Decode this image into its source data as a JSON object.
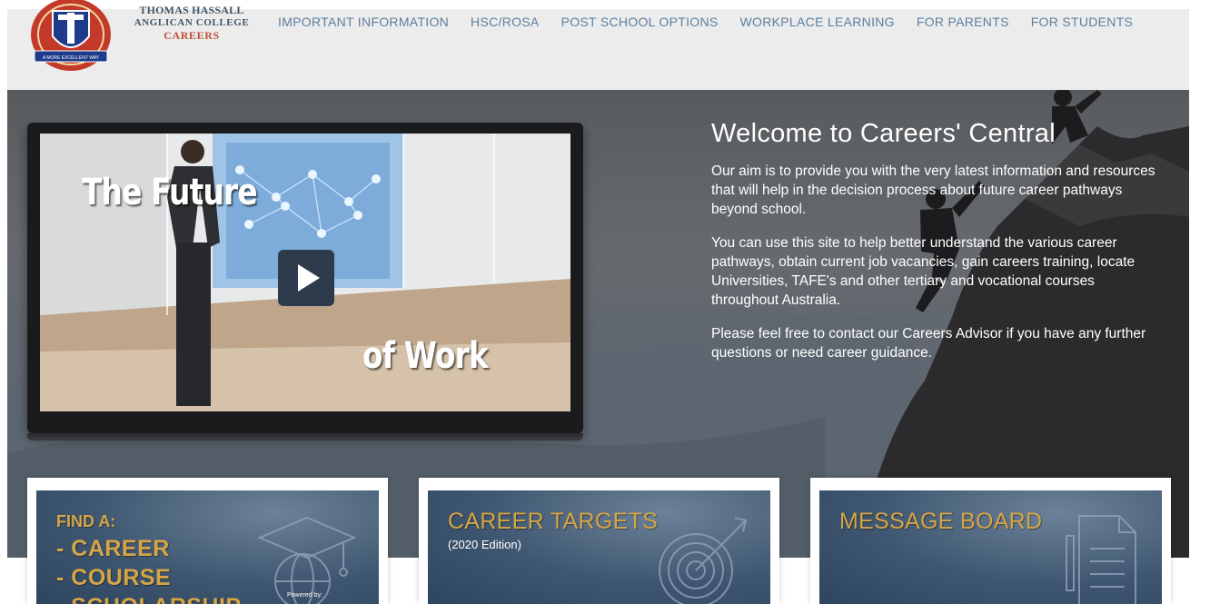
{
  "header": {
    "brand_line1": "THOMAS HASSALL",
    "brand_line2": "ANGLICAN COLLEGE",
    "brand_line3": "CAREERS",
    "crest_motto": "A MORE EXCELLENT WAY",
    "nav": [
      {
        "label": "IMPORTANT INFORMATION"
      },
      {
        "label": "HSC/ROSA"
      },
      {
        "label": "POST SCHOOL OPTIONS"
      },
      {
        "label": "WORKPLACE LEARNING"
      },
      {
        "label": "FOR PARENTS"
      },
      {
        "label": "FOR STUDENTS"
      }
    ]
  },
  "video": {
    "title_line1": "The Future",
    "title_line2": "of Work",
    "play_icon": "play-icon"
  },
  "welcome": {
    "heading": "Welcome to Careers' Central",
    "p1": "Our aim is to provide you with the very latest information and resources that will help in the decision process about future career pathways beyond school.",
    "p2": "You can use this site to help better understand the various career pathways, obtain current job vacancies, gain careers training, locate Universities, TAFE's and other tertiary and vocational courses throughout Australia.",
    "p3": "Please feel free to contact our Careers Advisor if you have any further questions or need career guidance."
  },
  "cards": {
    "find": {
      "heading": "FIND A:",
      "items": [
        "- CAREER",
        "- COURSE",
        "- SCHOLARSHIP"
      ],
      "powered": "Powered by:",
      "icon": "graduation-globe-icon"
    },
    "targets": {
      "title": "CAREER TARGETS",
      "subtitle": "(2020 Edition)",
      "icon": "target-arrow-icon"
    },
    "message": {
      "title": "MESSAGE BOARD",
      "icon": "document-icon"
    }
  },
  "colors": {
    "nav_text": "#5c7fa0",
    "brand_red": "#c04f3a",
    "card_gold": "#d6a546",
    "card_blue": "#3f5670"
  }
}
